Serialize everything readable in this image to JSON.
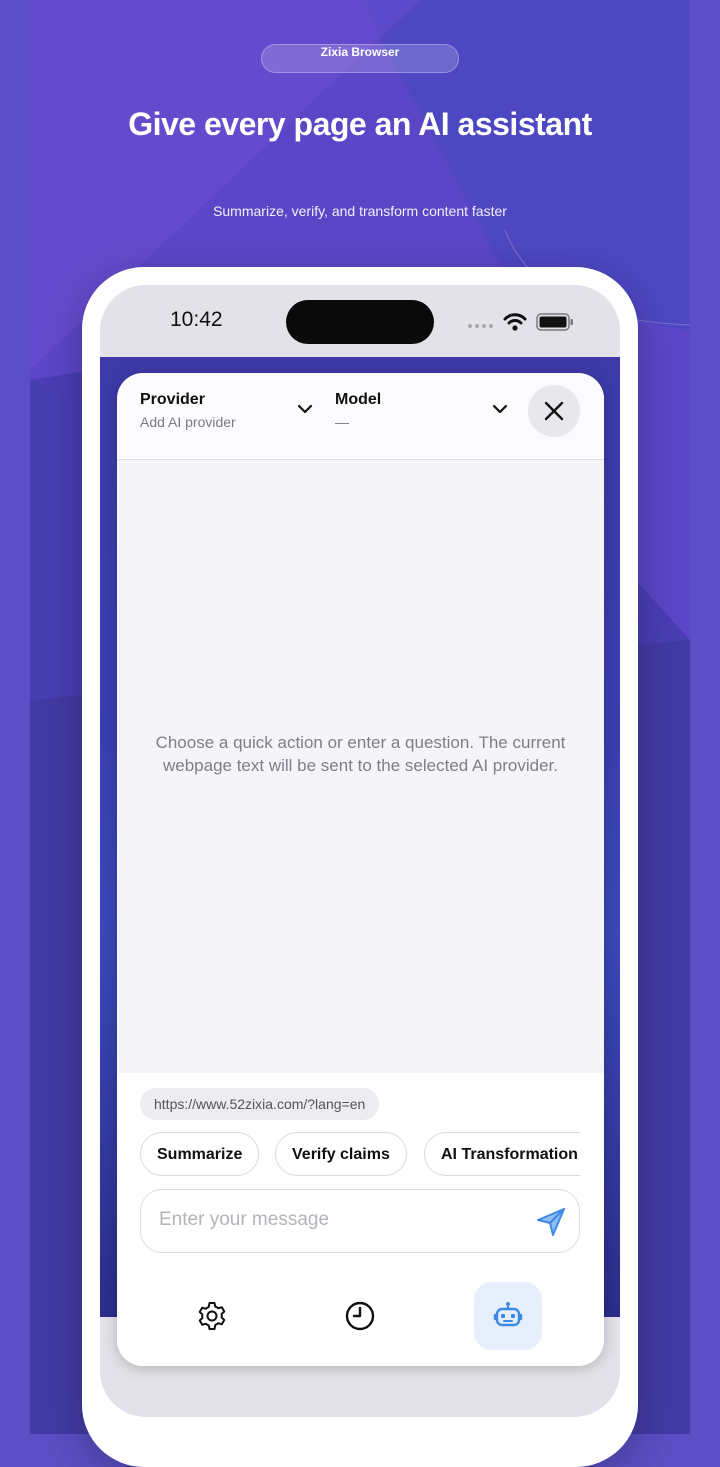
{
  "promo": {
    "badge": "Zixia Browser",
    "headline": "Give every page an AI assistant",
    "subheadline": "Summarize, verify, and transform content faster"
  },
  "status_bar": {
    "time": "10:42"
  },
  "assistant": {
    "provider_label": "Provider",
    "provider_value": "Add AI provider",
    "model_label": "Model",
    "model_value": "—",
    "empty_state": "Choose a quick action or enter a question. The current webpage text will be sent to the selected AI provider.",
    "page_url": "https://www.52zixia.com/?lang=en",
    "quick_actions": [
      "Summarize",
      "Verify claims",
      "AI Transformation"
    ],
    "message_placeholder": "Enter your message",
    "tabs": [
      {
        "icon": "gear-icon",
        "active": false
      },
      {
        "icon": "clock-icon",
        "active": false
      },
      {
        "icon": "robot-icon",
        "active": true
      }
    ]
  },
  "colors": {
    "background": "#5a4fc4",
    "accent": "#3d8ae6",
    "active_tab_bg": "#e6f0fd"
  }
}
